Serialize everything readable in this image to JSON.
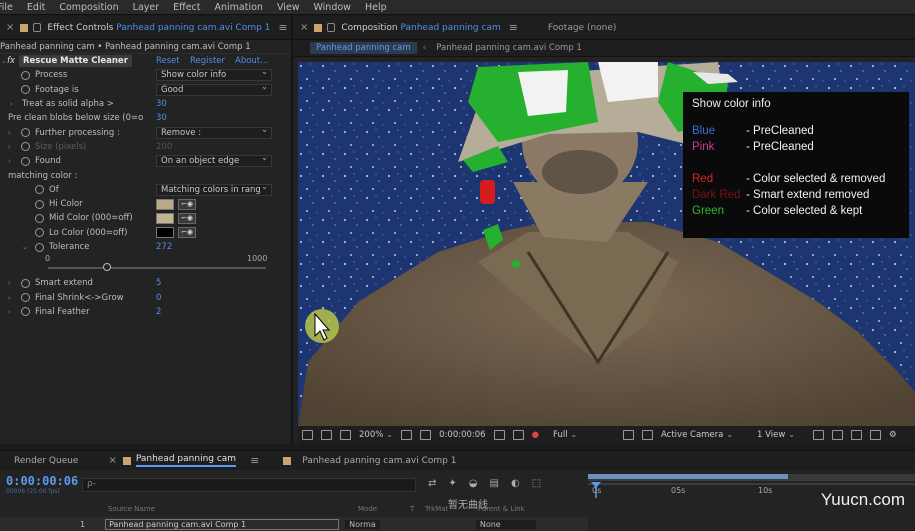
{
  "menu": [
    "File",
    "Edit",
    "Composition",
    "Layer",
    "Effect",
    "Animation",
    "View",
    "Window",
    "Help"
  ],
  "effect_controls": {
    "tab_label": "Effect Controls",
    "tab_layer": "Panhead panning cam.avi Comp 1",
    "header": "Panhead panning cam • Panhead panning cam.avi Comp 1",
    "effect_name": "Rescue Matte Cleaner",
    "links": {
      "reset": "Reset",
      "register": "Register",
      "about": "About..."
    },
    "rows": [
      {
        "name": "Process",
        "type": "dropdown",
        "value": "Show color info"
      },
      {
        "name": "Footage is",
        "type": "dropdown",
        "value": "Good"
      },
      {
        "name": "Treat as solid alpha >",
        "type": "number",
        "value": "30"
      },
      {
        "name": "Pre clean blobs below size (0=o",
        "type": "number",
        "value": "30"
      },
      {
        "name": "Further processing :",
        "type": "dropdown",
        "value": "Remove :"
      },
      {
        "name": "Size (pixels)",
        "type": "number",
        "value": "200",
        "disabled": true
      },
      {
        "name": "Found",
        "type": "dropdown",
        "value": "On an object edge"
      },
      {
        "name": "matching color :",
        "type": "group",
        "value": ""
      },
      {
        "name": "Of",
        "type": "dropdown",
        "value": "Matching colors in rang"
      },
      {
        "name": "Hi Color",
        "type": "color",
        "value": "#b8aa88"
      },
      {
        "name": "Mid Color (000=off)",
        "type": "color",
        "value": "#c2b48e"
      },
      {
        "name": "Lo Color (000=off)",
        "type": "color",
        "value": "#000000"
      },
      {
        "name": "Tolerance",
        "type": "number",
        "value": "272"
      },
      {
        "name": "Smart extend",
        "type": "number",
        "value": "5"
      },
      {
        "name": "Final Shrink<->Grow",
        "type": "number",
        "value": "0"
      },
      {
        "name": "Final Feather",
        "type": "number",
        "value": "2"
      }
    ],
    "slider": {
      "min": "0",
      "max": "1000",
      "value": 272
    }
  },
  "composition": {
    "tab_label": "Composition",
    "tab_comp": "Panhead panning cam",
    "footage_tab": "Footage (none)",
    "subtabs": [
      "Panhead panning cam",
      "Panhead panning cam.avi Comp 1"
    ],
    "toolbar": {
      "zoom": "200%",
      "timecode": "0:00:00:06",
      "resolution": "Full",
      "camera": "Active Camera",
      "views": "1 View"
    }
  },
  "info_overlay": {
    "title": "Show color info",
    "legend": [
      {
        "key": "Blue",
        "color": "#3f6fd8",
        "desc": "- PreCleaned"
      },
      {
        "key": "Pink",
        "color": "#d03a9c",
        "desc": "- PreCleaned"
      },
      {
        "key": "Red",
        "color": "#d92424",
        "desc": "- Color selected & removed"
      },
      {
        "key": "Dark Red",
        "color": "#7a1414",
        "desc": "- Smart extend removed"
      },
      {
        "key": "Green",
        "color": "#2fba3a",
        "desc": "- Color selected & kept"
      }
    ]
  },
  "timeline": {
    "tabs": [
      "Render Queue",
      "Panhead panning cam",
      "Panhead panning cam.avi Comp 1"
    ],
    "timecode": "0:00:00:06",
    "fps": "00006 (25.00 fps)",
    "search_placeholder": "ρ-",
    "columns": [
      "Source Name",
      "Mode",
      "T",
      "TrkMat",
      "Parent & Link"
    ],
    "layer": {
      "num": "1",
      "name": "Panhead panning cam.avi Comp 1",
      "mode": "Norma",
      "parent": "None"
    },
    "ruler": [
      "0s",
      "05s",
      "10s"
    ]
  },
  "watermarks": {
    "site": "Yuucn.com",
    "cn": "暂无曲线"
  }
}
